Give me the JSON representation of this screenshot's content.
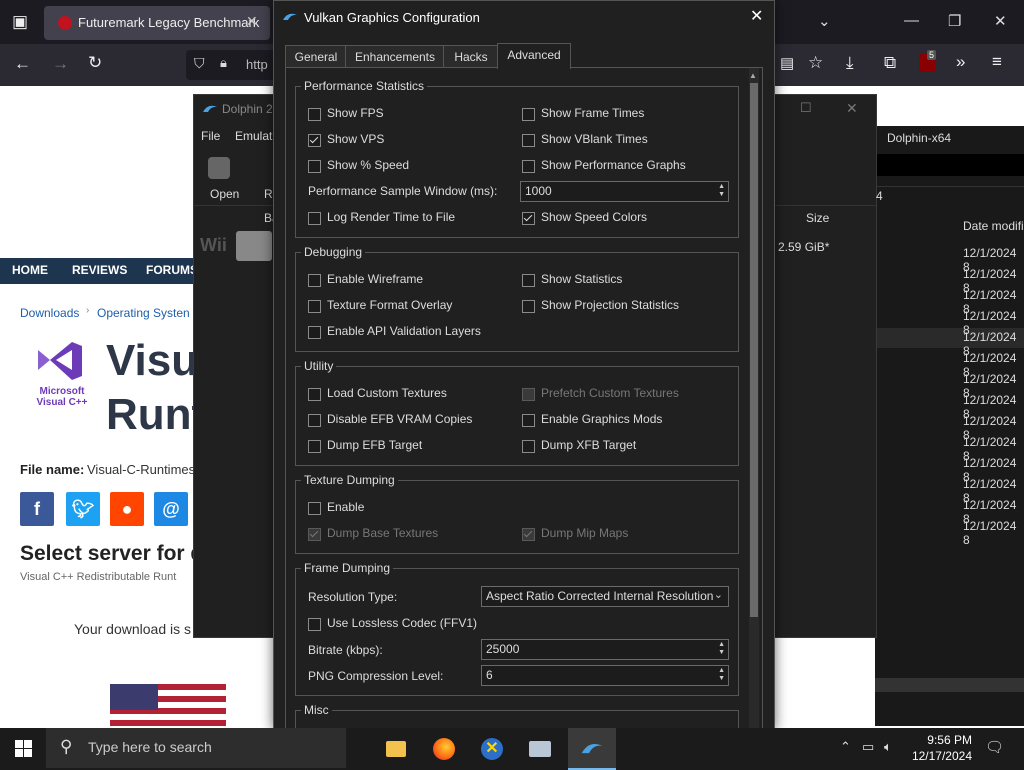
{
  "browser": {
    "tab_title": "Futuremark Legacy Benchmark",
    "url_fragment": "http",
    "extension_badge": "5",
    "site": {
      "nav": [
        "HOME",
        "REVIEWS",
        "FORUMS"
      ],
      "breadcrumb": [
        "Downloads",
        "Operating Systen"
      ],
      "logo_text": "Microsoft Visual C++",
      "title_line1": "Visua",
      "title_line2": "Runt",
      "file_name_label": "File name:",
      "file_name_value": "Visual-C-Runtimes",
      "select_server": "Select server for d",
      "sub_text": "Visual C++ Redistributable Runt",
      "download_text": "Your download is s"
    }
  },
  "dolphin": {
    "title": "Dolphin 2",
    "menu": [
      "File",
      "Emulati"
    ],
    "toolbar": [
      "Open",
      "R"
    ],
    "list_header_partial": "Ba",
    "platform_label": "Wii",
    "right_title": "Dolphin-x64",
    "right_col_partial": "4",
    "size_header": "Size",
    "size_value": "2.59 GiB*",
    "date_header": "Date modifi",
    "dates": [
      "12/1/2024 8",
      "12/1/2024 8",
      "12/1/2024 8",
      "12/1/2024 8",
      "12/1/2024 8",
      "12/1/2024 8",
      "12/1/2024 8",
      "12/1/2024 8",
      "12/1/2024 8",
      "12/1/2024 8",
      "12/1/2024 8",
      "12/1/2024 8",
      "12/1/2024 8",
      "12/1/2024 8"
    ]
  },
  "dialog": {
    "title": "Vulkan Graphics Configuration",
    "tabs": [
      "General",
      "Enhancements",
      "Hacks",
      "Advanced"
    ],
    "performance": {
      "label": "Performance Statistics",
      "show_fps": "Show FPS",
      "show_frame_times": "Show Frame Times",
      "show_vps": "Show VPS",
      "show_vblank": "Show VBlank Times",
      "show_speed": "Show % Speed",
      "show_perf_graphs": "Show Performance Graphs",
      "sample_window_label": "Performance Sample Window (ms):",
      "sample_window_value": "1000",
      "log_render": "Log Render Time to File",
      "speed_colors": "Show Speed Colors"
    },
    "debugging": {
      "label": "Debugging",
      "wireframe": "Enable Wireframe",
      "statistics": "Show Statistics",
      "tex_overlay": "Texture Format Overlay",
      "proj_stats": "Show Projection Statistics",
      "api_validation": "Enable API Validation Layers"
    },
    "utility": {
      "label": "Utility",
      "load_custom": "Load Custom Textures",
      "prefetch": "Prefetch Custom Textures",
      "disable_efb": "Disable EFB VRAM Copies",
      "graphics_mods": "Enable Graphics Mods",
      "dump_efb": "Dump EFB Target",
      "dump_xfb": "Dump XFB Target"
    },
    "texture_dumping": {
      "label": "Texture Dumping",
      "enable": "Enable",
      "dump_base": "Dump Base Textures",
      "dump_mip": "Dump Mip Maps"
    },
    "frame_dumping": {
      "label": "Frame Dumping",
      "resolution_label": "Resolution Type:",
      "resolution_value": "Aspect Ratio Corrected Internal Resolution",
      "lossless": "Use Lossless Codec (FFV1)",
      "bitrate_label": "Bitrate (kbps):",
      "bitrate_value": "25000",
      "png_label": "PNG Compression Level:",
      "png_value": "6"
    },
    "misc": {
      "label": "Misc"
    }
  },
  "taskbar": {
    "search_placeholder": "Type here to search",
    "time": "9:56 PM",
    "date": "12/17/2024"
  },
  "colors": {
    "dialog_bg": "#202020",
    "accent": "#76b9ed",
    "site_nav": "#1e3550",
    "site_link": "#1f5ea8"
  }
}
